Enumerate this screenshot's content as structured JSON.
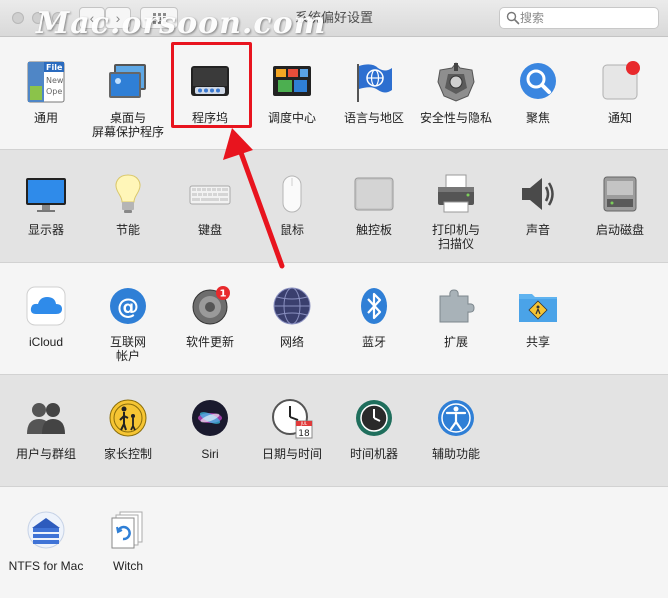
{
  "window": {
    "title": "系统偏好设置",
    "watermark": "Mac.orsoon.com",
    "back_label": "‹",
    "forward_label": "›",
    "search": {
      "placeholder": "搜索"
    }
  },
  "sections": [
    {
      "panes": [
        {
          "label": "通用",
          "icon": "general-icon"
        },
        {
          "label": "桌面与\n屏幕保护程序",
          "icon": "desktop-screensaver-icon"
        },
        {
          "label": "程序坞",
          "icon": "dock-icon"
        },
        {
          "label": "调度中心",
          "icon": "mission-control-icon"
        },
        {
          "label": "语言与地区",
          "icon": "language-region-icon"
        },
        {
          "label": "安全性与隐私",
          "icon": "security-privacy-icon"
        },
        {
          "label": "聚焦",
          "icon": "spotlight-icon"
        },
        {
          "label": "通知",
          "icon": "notifications-icon"
        }
      ]
    },
    {
      "panes": [
        {
          "label": "显示器",
          "icon": "displays-icon"
        },
        {
          "label": "节能",
          "icon": "energy-saver-icon"
        },
        {
          "label": "键盘",
          "icon": "keyboard-icon"
        },
        {
          "label": "鼠标",
          "icon": "mouse-icon"
        },
        {
          "label": "触控板",
          "icon": "trackpad-icon"
        },
        {
          "label": "打印机与\n扫描仪",
          "icon": "printers-scanners-icon"
        },
        {
          "label": "声音",
          "icon": "sound-icon"
        },
        {
          "label": "启动磁盘",
          "icon": "startup-disk-icon"
        }
      ]
    },
    {
      "panes": [
        {
          "label": "iCloud",
          "icon": "icloud-icon"
        },
        {
          "label": "互联网\n帐户",
          "icon": "internet-accounts-icon"
        },
        {
          "label": "软件更新",
          "icon": "software-update-icon",
          "badge": "1"
        },
        {
          "label": "网络",
          "icon": "network-icon"
        },
        {
          "label": "蓝牙",
          "icon": "bluetooth-icon"
        },
        {
          "label": "扩展",
          "icon": "extensions-icon"
        },
        {
          "label": "共享",
          "icon": "sharing-icon"
        }
      ]
    },
    {
      "panes": [
        {
          "label": "用户与群组",
          "icon": "users-groups-icon"
        },
        {
          "label": "家长控制",
          "icon": "parental-controls-icon"
        },
        {
          "label": "Siri",
          "icon": "siri-icon"
        },
        {
          "label": "日期与时间",
          "icon": "date-time-icon",
          "date_text": "18",
          "month_text": "JUL"
        },
        {
          "label": "时间机器",
          "icon": "time-machine-icon"
        },
        {
          "label": "辅助功能",
          "icon": "accessibility-icon"
        }
      ]
    },
    {
      "panes": [
        {
          "label": "NTFS for Mac",
          "icon": "ntfs-icon"
        },
        {
          "label": "Witch",
          "icon": "witch-icon"
        }
      ]
    }
  ],
  "general_icon_text": [
    "File",
    "New",
    "Ope"
  ],
  "colors": {
    "highlight": "#e8141e",
    "section_a": "#f5f5f5",
    "section_b": "#e3e3e3"
  }
}
